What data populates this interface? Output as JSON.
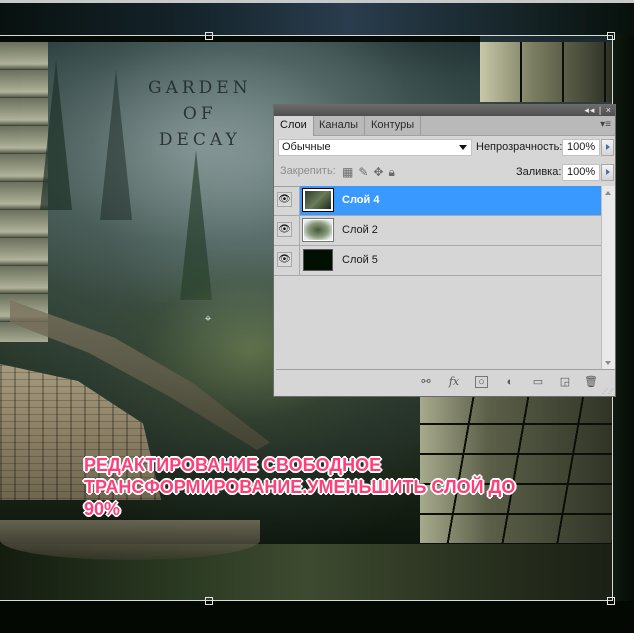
{
  "canvas": {
    "artwork_title_lines": [
      "GARDEN",
      "OF",
      "DECAY"
    ],
    "instruction_text": "РЕДАКТИРОВАНИЕ СВОБОДНОЕ ТРАНСФОРМИРОВАНИЕ.УМЕНЬШИТЬ СЛОЙ ДО 90%",
    "instruction_color": "#ff3f7a"
  },
  "panel": {
    "collapse_icon": "◂◂",
    "close_icon": "×",
    "tabs": [
      {
        "label": "Слои",
        "active": true
      },
      {
        "label": "Каналы",
        "active": false
      },
      {
        "label": "Контуры",
        "active": false
      }
    ],
    "menu_icon": "▾≡",
    "blend_mode": "Обычные",
    "opacity_label": "Непрозрачность:",
    "opacity_value": "100%",
    "lock_label": "Закрепить:",
    "lock_icons": [
      "lock-transparent-icon",
      "brush-icon",
      "move-icon",
      "lock-icon"
    ],
    "fill_label": "Заливка:",
    "fill_value": "100%",
    "layers": [
      {
        "name": "Слой 4",
        "selected": true,
        "visible": true
      },
      {
        "name": "Слой 2",
        "selected": false,
        "visible": true
      },
      {
        "name": "Слой 5",
        "selected": false,
        "visible": true
      }
    ],
    "footer_icons": [
      "link-icon",
      "fx-icon",
      "mask-icon",
      "adjustment-icon",
      "folder-icon",
      "new-layer-icon",
      "trash-icon"
    ],
    "selection_color": "#3a99ff"
  }
}
